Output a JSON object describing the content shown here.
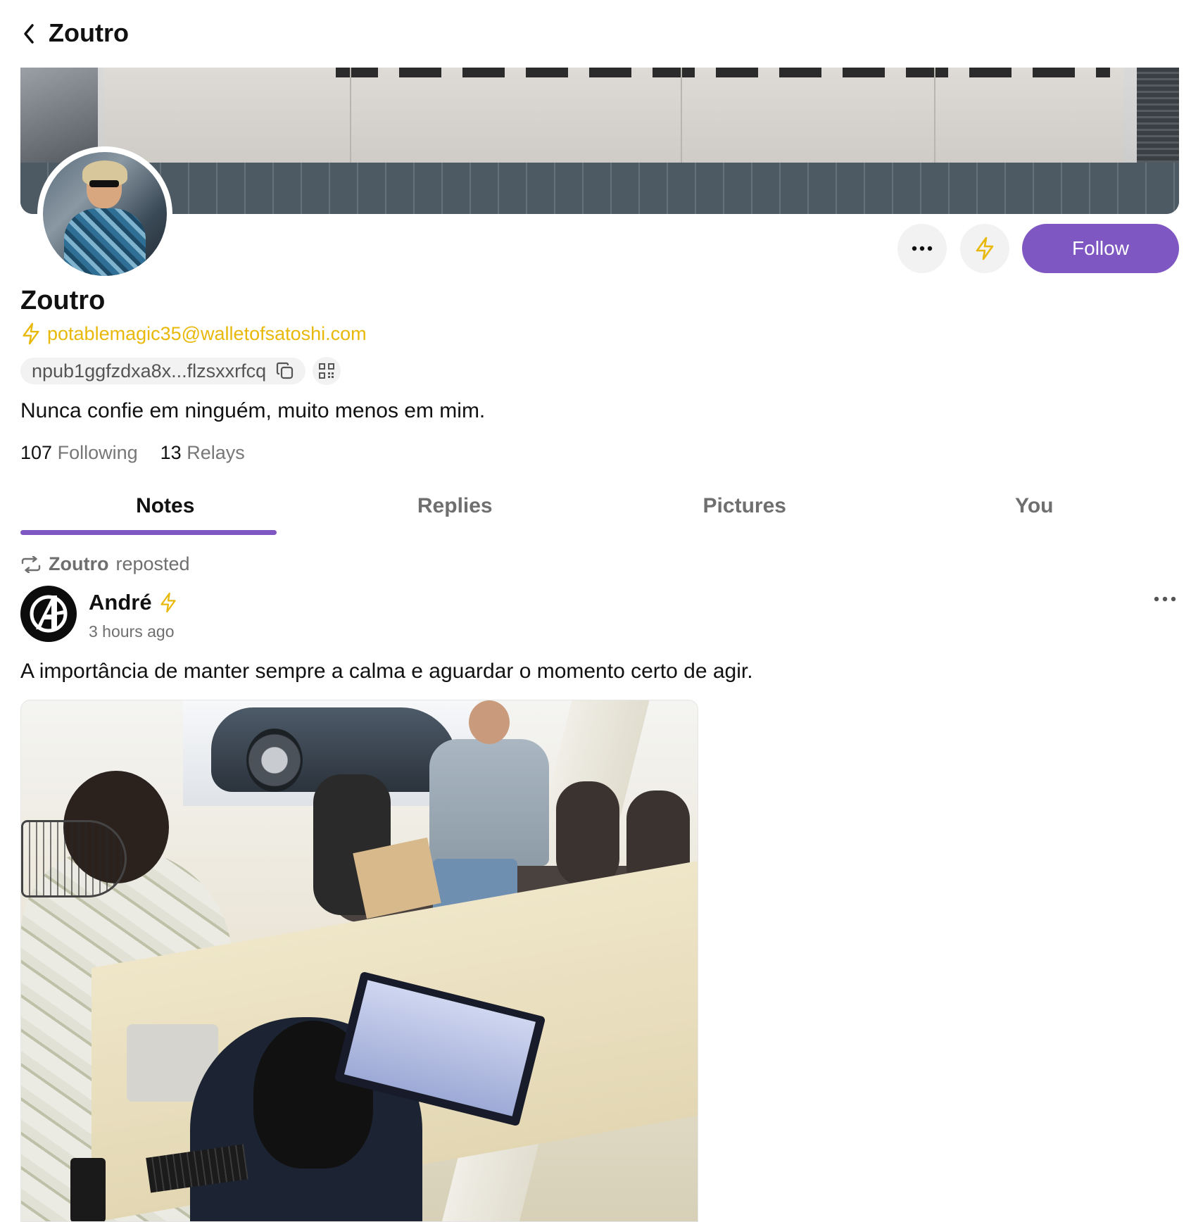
{
  "header": {
    "title": "Zoutro"
  },
  "profile": {
    "name": "Zoutro",
    "lightning_address": "potablemagic35@walletofsatoshi.com",
    "npub": "npub1ggfzdxa8x...flzsxxrfcq",
    "bio": "Nunca confie em ninguém, muito menos em mim.",
    "follow_label": "Follow",
    "stats": [
      {
        "value": "107",
        "label": "Following"
      },
      {
        "value": "13",
        "label": "Relays"
      }
    ]
  },
  "tabs": [
    {
      "label": "Notes",
      "active": true
    },
    {
      "label": "Replies",
      "active": false
    },
    {
      "label": "Pictures",
      "active": false
    },
    {
      "label": "You",
      "active": false
    }
  ],
  "feed": {
    "posts": [
      {
        "repost_by": "Zoutro",
        "repost_label": "reposted",
        "author": "André",
        "time": "3 hours ago",
        "text": "A importância de manter sempre a calma e aguardar o momento certo de agir."
      }
    ]
  },
  "colors": {
    "accent": "#7e57c2",
    "lightning": "#e8b90b",
    "muted_text": "#6f6f6f",
    "pill_bg": "#f2f2f2"
  },
  "icons": {
    "back": "chevron-left-icon",
    "more": "more-horizontal-icon",
    "zap": "lightning-icon",
    "copy": "copy-icon",
    "qr": "qr-code-icon",
    "repost": "repost-icon"
  }
}
